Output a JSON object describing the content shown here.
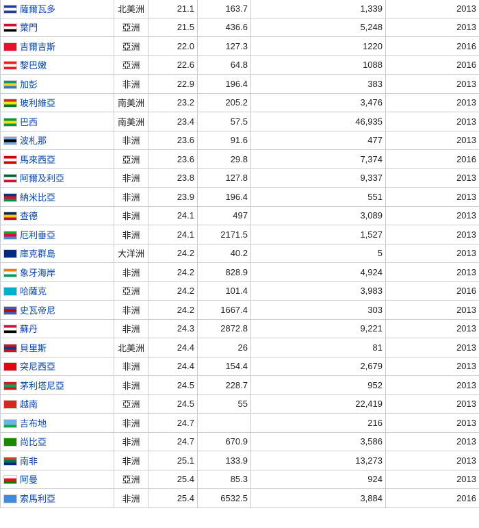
{
  "rows": [
    {
      "flag_icon": "el-salvador-flag-icon",
      "flag_colors": [
        "#1a3fa0",
        "#ffffff",
        "#1a3fa0"
      ],
      "country": "薩爾瓦多",
      "continent": "北美洲",
      "rate": "21.1",
      "mortality": "163.7",
      "births": "1,339",
      "year": "2013"
    },
    {
      "flag_icon": "yemen-flag-icon",
      "flag_colors": [
        "#ce1126",
        "#ffffff",
        "#000000"
      ],
      "country": "葉門",
      "continent": "亞洲",
      "rate": "21.5",
      "mortality": "436.6",
      "births": "5,248",
      "year": "2013"
    },
    {
      "flag_icon": "kyrgyzstan-flag-icon",
      "flag_colors": [
        "#e8112d",
        "#e8112d",
        "#e8112d"
      ],
      "country": "吉爾吉斯",
      "continent": "亞洲",
      "rate": "22.0",
      "mortality": "127.3",
      "births": "1220",
      "year": "2016"
    },
    {
      "flag_icon": "lebanon-flag-icon",
      "flag_colors": [
        "#ed1c24",
        "#ffffff",
        "#ed1c24"
      ],
      "country": "黎巴嫩",
      "continent": "亞洲",
      "rate": "22.6",
      "mortality": "64.8",
      "births": "1088",
      "year": "2016"
    },
    {
      "flag_icon": "gabon-flag-icon",
      "flag_colors": [
        "#009e60",
        "#fcd116",
        "#3a75c4"
      ],
      "country": "加彭",
      "continent": "非洲",
      "rate": "22.9",
      "mortality": "196.4",
      "births": "383",
      "year": "2013"
    },
    {
      "flag_icon": "bolivia-flag-icon",
      "flag_colors": [
        "#d52b1e",
        "#f9e300",
        "#007934"
      ],
      "country": "玻利維亞",
      "continent": "南美洲",
      "rate": "23.2",
      "mortality": "205.2",
      "births": "3,476",
      "year": "2013"
    },
    {
      "flag_icon": "brazil-flag-icon",
      "flag_colors": [
        "#009c3b",
        "#ffdf00",
        "#009c3b"
      ],
      "country": "巴西",
      "continent": "南美洲",
      "rate": "23.4",
      "mortality": "57.5",
      "births": "46,935",
      "year": "2013"
    },
    {
      "flag_icon": "botswana-flag-icon",
      "flag_colors": [
        "#75aadb",
        "#000000",
        "#75aadb"
      ],
      "country": "波札那",
      "continent": "非洲",
      "rate": "23.6",
      "mortality": "91.6",
      "births": "477",
      "year": "2013"
    },
    {
      "flag_icon": "malaysia-flag-icon",
      "flag_colors": [
        "#cc0001",
        "#ffffff",
        "#cc0001"
      ],
      "country": "馬來西亞",
      "continent": "亞洲",
      "rate": "23.6",
      "mortality": "29.8",
      "births": "7,374",
      "year": "2016"
    },
    {
      "flag_icon": "algeria-flag-icon",
      "flag_colors": [
        "#006233",
        "#ffffff",
        "#d21034"
      ],
      "country": "阿爾及利亞",
      "continent": "非洲",
      "rate": "23.8",
      "mortality": "127.8",
      "births": "9,337",
      "year": "2013"
    },
    {
      "flag_icon": "namibia-flag-icon",
      "flag_colors": [
        "#003580",
        "#d21034",
        "#009543"
      ],
      "country": "納米比亞",
      "continent": "非洲",
      "rate": "23.9",
      "mortality": "196.4",
      "births": "551",
      "year": "2013"
    },
    {
      "flag_icon": "chad-flag-icon",
      "flag_colors": [
        "#002664",
        "#fecb00",
        "#c60c30"
      ],
      "country": "查德",
      "continent": "非洲",
      "rate": "24.1",
      "mortality": "497",
      "births": "3,089",
      "year": "2013"
    },
    {
      "flag_icon": "eritrea-flag-icon",
      "flag_colors": [
        "#12ad2b",
        "#ea0437",
        "#4189dd"
      ],
      "country": "厄利垂亞",
      "continent": "非洲",
      "rate": "24.1",
      "mortality": "2171.5",
      "births": "1,527",
      "year": "2013"
    },
    {
      "flag_icon": "cook-islands-flag-icon",
      "flag_colors": [
        "#002b7f",
        "#002b7f",
        "#002b7f"
      ],
      "country": "庫克群島",
      "continent": "大洋洲",
      "rate": "24.2",
      "mortality": "40.2",
      "births": "5",
      "year": "2013"
    },
    {
      "flag_icon": "ivory-coast-flag-icon",
      "flag_colors": [
        "#f77f00",
        "#ffffff",
        "#009e60"
      ],
      "country": "象牙海岸",
      "continent": "非洲",
      "rate": "24.2",
      "mortality": "828.9",
      "births": "4,924",
      "year": "2013"
    },
    {
      "flag_icon": "kazakhstan-flag-icon",
      "flag_colors": [
        "#00afca",
        "#00afca",
        "#00afca"
      ],
      "country": "哈薩克",
      "continent": "亞洲",
      "rate": "24.2",
      "mortality": "101.4",
      "births": "3,983",
      "year": "2016"
    },
    {
      "flag_icon": "eswatini-flag-icon",
      "flag_colors": [
        "#3e5eb9",
        "#b10c0c",
        "#3e5eb9"
      ],
      "country": "史瓦帝尼",
      "continent": "非洲",
      "rate": "24.2",
      "mortality": "1667.4",
      "births": "303",
      "year": "2013"
    },
    {
      "flag_icon": "sudan-flag-icon",
      "flag_colors": [
        "#d21034",
        "#ffffff",
        "#000000"
      ],
      "country": "蘇丹",
      "continent": "非洲",
      "rate": "24.3",
      "mortality": "2872.8",
      "births": "9,221",
      "year": "2013"
    },
    {
      "flag_icon": "belize-flag-icon",
      "flag_colors": [
        "#ce1126",
        "#003f87",
        "#ce1126"
      ],
      "country": "貝里斯",
      "continent": "北美洲",
      "rate": "24.4",
      "mortality": "26",
      "births": "81",
      "year": "2013"
    },
    {
      "flag_icon": "tunisia-flag-icon",
      "flag_colors": [
        "#e70013",
        "#e70013",
        "#e70013"
      ],
      "country": "突尼西亞",
      "continent": "非洲",
      "rate": "24.4",
      "mortality": "154.4",
      "births": "2,679",
      "year": "2013"
    },
    {
      "flag_icon": "mauritania-flag-icon",
      "flag_colors": [
        "#d01c1f",
        "#00a95c",
        "#d01c1f"
      ],
      "country": "茅利塔尼亞",
      "continent": "非洲",
      "rate": "24.5",
      "mortality": "228.7",
      "births": "952",
      "year": "2013"
    },
    {
      "flag_icon": "vietnam-flag-icon",
      "flag_colors": [
        "#da251d",
        "#da251d",
        "#da251d"
      ],
      "country": "越南",
      "continent": "亞洲",
      "rate": "24.5",
      "mortality": "55",
      "births": "22,419",
      "year": "2013"
    },
    {
      "flag_icon": "djibouti-flag-icon",
      "flag_colors": [
        "#6ab2e7",
        "#6ab2e7",
        "#12ad2b"
      ],
      "country": "吉布地",
      "continent": "非洲",
      "rate": "24.7",
      "mortality": "",
      "births": "216",
      "year": "2013"
    },
    {
      "flag_icon": "zambia-flag-icon",
      "flag_colors": [
        "#198a00",
        "#198a00",
        "#198a00"
      ],
      "country": "尚比亞",
      "continent": "非洲",
      "rate": "24.7",
      "mortality": "670.9",
      "births": "3,586",
      "year": "2013"
    },
    {
      "flag_icon": "south-africa-flag-icon",
      "flag_colors": [
        "#de3831",
        "#007a4d",
        "#002395"
      ],
      "country": "南非",
      "continent": "非洲",
      "rate": "25.1",
      "mortality": "133.9",
      "births": "13,273",
      "year": "2013"
    },
    {
      "flag_icon": "oman-flag-icon",
      "flag_colors": [
        "#ffffff",
        "#db161b",
        "#008000"
      ],
      "country": "阿曼",
      "continent": "亞洲",
      "rate": "25.4",
      "mortality": "85.3",
      "births": "924",
      "year": "2013"
    },
    {
      "flag_icon": "somalia-flag-icon",
      "flag_colors": [
        "#4189dd",
        "#4189dd",
        "#4189dd"
      ],
      "country": "索馬利亞",
      "continent": "非洲",
      "rate": "25.4",
      "mortality": "6532.5",
      "births": "3,884",
      "year": "2016"
    }
  ]
}
